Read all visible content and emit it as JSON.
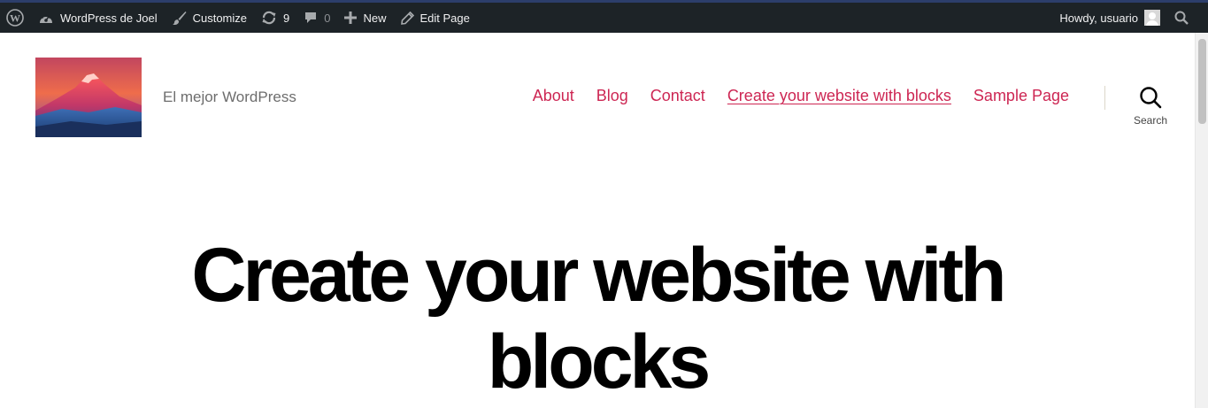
{
  "admin_bar": {
    "wp_logo_icon": "wordpress-logo-icon",
    "site_name": "WordPress de Joel",
    "customize_label": "Customize",
    "updates_count": "9",
    "comments_count": "0",
    "new_label": "New",
    "edit_label": "Edit Page",
    "howdy_text": "Howdy, usuario",
    "background_color": "#1d2327"
  },
  "header": {
    "site_description": "El mejor WordPress",
    "nav": [
      {
        "label": "About"
      },
      {
        "label": "Blog"
      },
      {
        "label": "Contact"
      },
      {
        "label": "Create your website with blocks",
        "current": true
      },
      {
        "label": "Sample Page"
      }
    ],
    "search_label": "Search",
    "accent_color": "#cd2653"
  },
  "page": {
    "title_line1": "Create your website with",
    "title_line2": "blocks"
  }
}
